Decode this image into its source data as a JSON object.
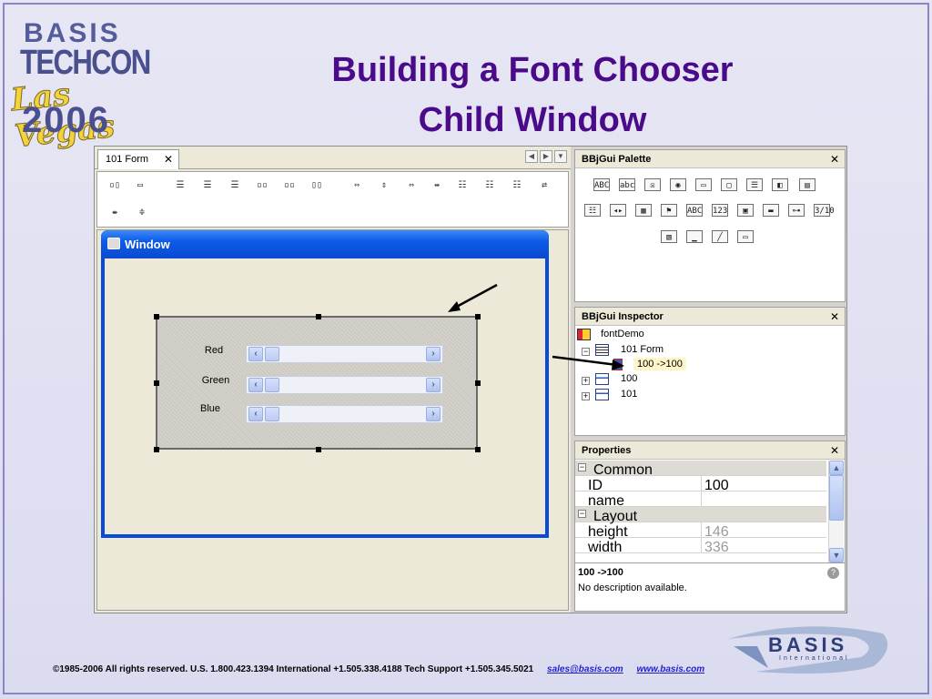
{
  "logo": {
    "line1": "BASIS",
    "line2": "TECHCON",
    "line3": "Las Vegas",
    "line4": "2006"
  },
  "title": {
    "line1": "Building a Font Chooser",
    "line2": "Child Window"
  },
  "editor": {
    "tab_label": "101 Form",
    "window_title": "Window",
    "rows": [
      {
        "label": "Red"
      },
      {
        "label": "Green"
      },
      {
        "label": "Blue"
      }
    ]
  },
  "palette": {
    "title": "BBjGui Palette"
  },
  "inspector": {
    "title": "BBjGui Inspector",
    "tree": [
      "fontDemo",
      "101 Form",
      "100 ->100",
      "100",
      "101"
    ]
  },
  "properties": {
    "title": "Properties",
    "rows": [
      {
        "name": "Common",
        "value": "",
        "category": true
      },
      {
        "name": "ID",
        "value": "100"
      },
      {
        "name": "name",
        "value": ""
      },
      {
        "name": "Layout",
        "value": "",
        "category": true
      },
      {
        "name": "height",
        "value": "146"
      },
      {
        "name": "width",
        "value": "336"
      }
    ],
    "desc_title": "100 ->100",
    "desc_text": "No description available."
  },
  "footer": {
    "text": "©1985-2006  All rights reserved.   U.S. 1.800.423.1394    International +1.505.338.4188   Tech Support +1.505.345.5021",
    "email": "sales@basis.com",
    "web": "www.basis.com"
  },
  "basis_logo": {
    "name": "BASIS",
    "sub": "International"
  },
  "colors": {
    "title": "#4a0a8a",
    "window_titlebar": "#0c5be8",
    "link": "#1f1fd0"
  }
}
